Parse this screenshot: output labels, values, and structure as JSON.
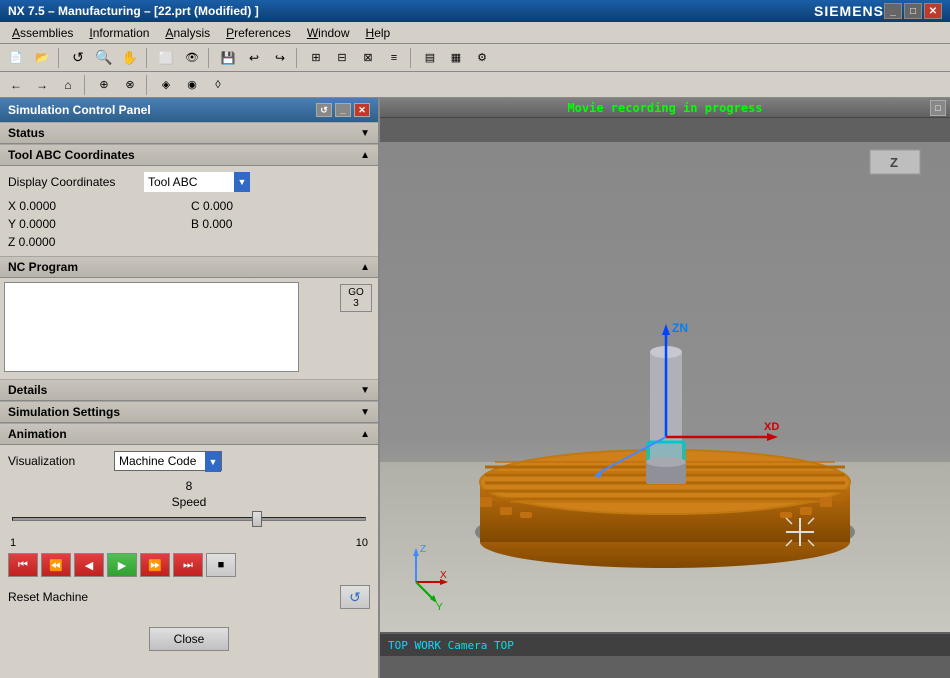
{
  "window": {
    "title": "NX 7.5 – Manufacturing – [22.prt (Modified) ]",
    "brand": "SIEMENS"
  },
  "menu": {
    "items": [
      "Assemblies",
      "Information",
      "Analysis",
      "Preferences",
      "Window",
      "Help"
    ]
  },
  "sim_panel": {
    "title": "Simulation Control Panel",
    "status_label": "Status",
    "tool_coords_label": "Tool ABC Coordinates",
    "display_coords_label": "Display Coordinates",
    "display_coords_value": "Tool ABC",
    "x_label": "X 0.0000",
    "y_label": "Y 0.0000",
    "z_label": "Z 0.0000",
    "c_label": "C 0.000",
    "b_label": "B 0.000",
    "nc_program_label": "NC Program",
    "details_label": "Details",
    "sim_settings_label": "Simulation Settings",
    "animation_label": "Animation",
    "visualization_label": "Visualization",
    "visualization_value": "Machine Code",
    "speed_label": "Speed",
    "speed_value": "8",
    "slider_min": "1",
    "slider_max": "10",
    "reset_machine_label": "Reset Machine",
    "close_label": "Close",
    "go_btn": "GO\n3",
    "play_btns": [
      "⏮",
      "⏭",
      "◀",
      "▶",
      "⏩",
      "⏪",
      "■"
    ]
  },
  "viewport": {
    "movie_text": "Movie recording in progress",
    "z_label": "Z",
    "status_text": "TOP WORK Camera TOP"
  }
}
